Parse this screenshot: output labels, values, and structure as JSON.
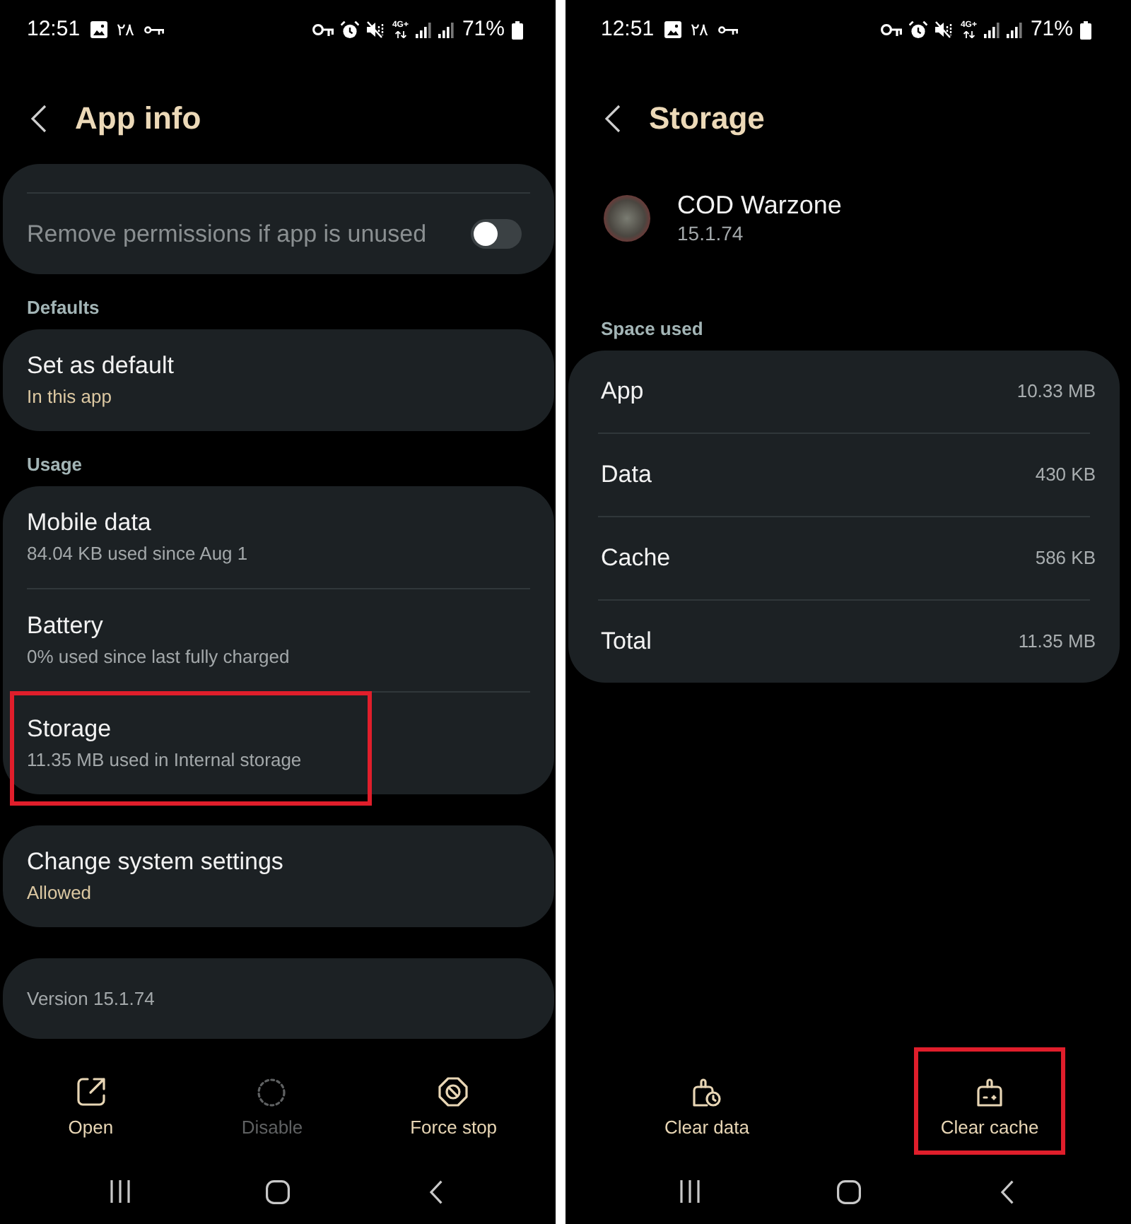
{
  "app_info_screen": {
    "status_bar": {
      "time": "12:51",
      "date": "۲۸",
      "network_type": "4G+",
      "battery": "71%"
    },
    "title": "App info",
    "groups": [
      {
        "cut_off_top": true,
        "items": [
          {
            "kind": "toggle",
            "label": "Remove permissions if app is unused",
            "disabled": true,
            "on": false
          }
        ]
      },
      {
        "heading": "Defaults",
        "items": [
          {
            "kind": "entry",
            "label": "Set as default",
            "summary": "In this app",
            "summary_accent": true,
            "highlighted": false
          }
        ]
      },
      {
        "heading": "Usage",
        "items": [
          {
            "kind": "entry",
            "label": "Mobile data",
            "summary": "84.04 KB used since Aug 1",
            "summary_accent": false,
            "highlighted": false
          },
          {
            "kind": "entry",
            "label": "Battery",
            "summary": "0% used since last fully charged",
            "summary_accent": false,
            "highlighted": false
          },
          {
            "kind": "entry",
            "label": "Storage",
            "summary": "11.35 MB used in Internal storage",
            "summary_accent": false,
            "highlighted": true
          }
        ]
      },
      {
        "items": [
          {
            "kind": "entry",
            "label": "Change system settings",
            "summary": "Allowed",
            "summary_accent": true,
            "highlighted": false
          }
        ]
      },
      {
        "items": [
          {
            "kind": "note",
            "label": "Version 15.1.74"
          }
        ]
      }
    ],
    "actions": [
      {
        "kind": "open",
        "label": "Open",
        "disabled": false,
        "highlighted": false
      },
      {
        "kind": "disable",
        "label": "Disable",
        "disabled": true,
        "highlighted": false
      },
      {
        "kind": "force_stop",
        "label": "Force stop",
        "disabled": false,
        "highlighted": false
      }
    ]
  },
  "storage_screen": {
    "status_bar": {
      "time": "12:51",
      "date": "۲۸",
      "network_type": "4G+",
      "battery": "71%"
    },
    "title": "Storage",
    "app": {
      "name": "COD Warzone",
      "version": "15.1.74"
    },
    "section_heading": "Space used",
    "rows": [
      {
        "label": "App",
        "value": "10.33 MB"
      },
      {
        "label": "Data",
        "value": "430 KB"
      },
      {
        "label": "Cache",
        "value": "586 KB"
      },
      {
        "label": "Total",
        "value": "11.35 MB"
      }
    ],
    "actions": [
      {
        "kind": "clear_data",
        "label": "Clear data",
        "disabled": false,
        "highlighted": false
      },
      {
        "kind": "clear_cache",
        "label": "Clear cache",
        "disabled": false,
        "highlighted": true
      }
    ]
  }
}
